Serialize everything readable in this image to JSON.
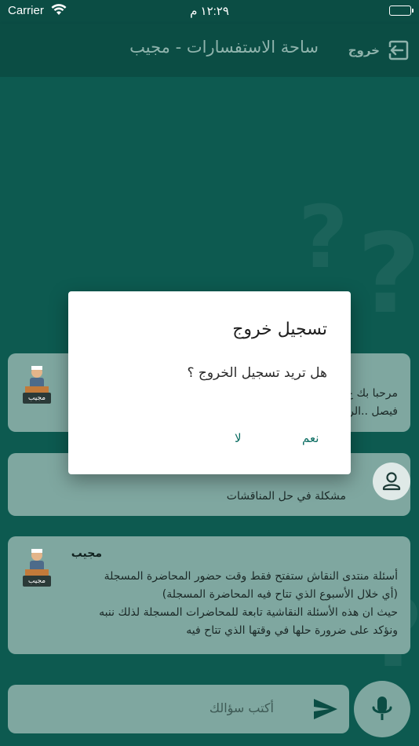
{
  "status_bar": {
    "carrier": "Carrier",
    "time": "١٢:٢٩ م"
  },
  "nav": {
    "title": "ساحة الاستفسارات - مجيب",
    "logout_label": "خروج"
  },
  "messages": [
    {
      "sender": "",
      "lines": [
        "مرحبا بك ع",
        "فيصل ..الر"
      ],
      "avatar_badge": "مجيب"
    },
    {
      "sender": "",
      "lines": [
        "مشكلة في حل المناقشات"
      ]
    },
    {
      "sender": "مجيب",
      "lines": [
        "أسئلة منتدى النقاش ستفتح فقط وقت حضور المحاضرة المسجلة",
        "(أي خلال الأسبوع الذي تتاح فيه المحاضرة المسجلة)",
        "حيث ان هذه الأسئلة النقاشية تابعة للمحاضرات المسجلة لذلك ننبه",
        "ونؤكد على ضرورة حلها في وقتها الذي تتاح فيه"
      ],
      "avatar_badge": "مجيب"
    }
  ],
  "composer": {
    "placeholder": "أكتب سؤالك"
  },
  "dialog": {
    "title": "تسجيل خروج",
    "body": "هل تريد تسجيل الخروج ؟",
    "yes_label": "نعم",
    "no_label": "لا"
  },
  "colors": {
    "background": "#0d5a50",
    "card": "#7fa7a0",
    "accent": "#0b6d62"
  }
}
